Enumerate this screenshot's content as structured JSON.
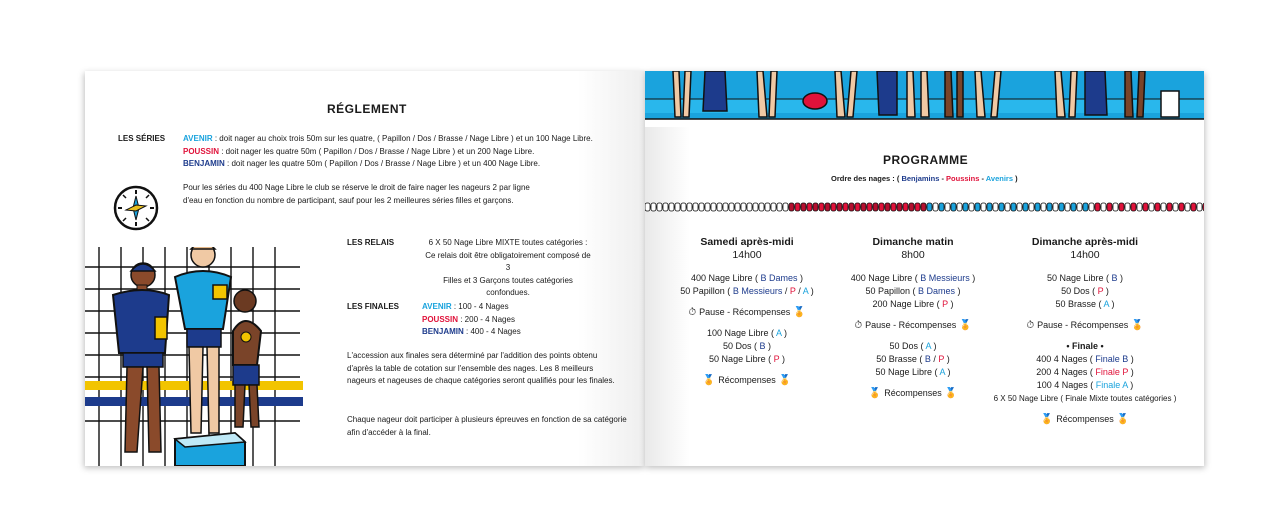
{
  "left": {
    "title": "RÉGLEMENT",
    "series_label": "LES SÉRIES",
    "series": [
      {
        "name": "AVENIR",
        "text": " : doit nager au choix trois 50m sur les quatre, ( Papillon / Dos / Brasse / Nage Libre ) et un 100 Nage Libre."
      },
      {
        "name": "POUSSIN",
        "text": " : doit nager les quatre 50m ( Papillon / Dos / Brasse / Nage Libre ) et un 200 Nage Libre."
      },
      {
        "name": "BENJAMIN",
        "text": " : doit nager les quatre 50m ( Papillon / Dos / Brasse / Nage Libre ) et un 400 Nage Libre."
      }
    ],
    "series_note_1": "Pour les séries du 400 Nage Libre le club se réserve le droit de faire nager les nageurs 2 par ligne",
    "series_note_2": "d'eau en fonction du nombre de participant, sauf pour les 2 meilleures séries filles et garçons.",
    "relais_label": "LES RELAIS",
    "relais_lines": [
      "6 X 50 Nage Libre MIXTE toutes catégories :",
      "Ce relais doit être obligatoirement composé de 3",
      "Filles et 3 Garçons toutes catégories confondues."
    ],
    "finales_label": "LES FINALES",
    "finales": [
      {
        "name": "AVENIR",
        "text": " : 100 - 4 Nages"
      },
      {
        "name": "POUSSIN",
        "text": " : 200 - 4 Nages"
      },
      {
        "name": "BENJAMIN",
        "text": " : 400 - 4 Nages"
      }
    ],
    "access_lines": [
      "L'accession aux finales sera déterminé par l'addition des points obtenu",
      "d'après la table de cotation sur l'ensemble des nages. Les 8 meilleurs",
      "nageurs et nageuses de chaque catégories seront qualifiés pour les finales."
    ],
    "chaque_lines": [
      "Chaque nageur doit participer à plusieurs épreuves en fonction de sa catégorie",
      "afin d'accéder à la final."
    ]
  },
  "right": {
    "title": "PROGRAMME",
    "order_prefix": "Ordre des nages : ( ",
    "order_benjamins": "Benjamins",
    "order_sep": " - ",
    "order_poussins": "Poussins",
    "order_avenirs": "Avenirs",
    "order_suffix": " )",
    "pause_label": "Pause - Récompenses",
    "recomp_label": "Récompenses",
    "finale_label": "• Finale •",
    "samedi": {
      "title": "Samedi après-midi",
      "time": "14h00",
      "b1l1_pre": "400 Nage Libre ( ",
      "b1l1_a": "B Dames",
      "b1l1_post": " )",
      "b1l2_pre": "50 Papillon ( ",
      "b1l2_a": "B Messieurs",
      "b1l2_s1": " / ",
      "b1l2_b": "P",
      "b1l2_s2": " / ",
      "b1l2_c": "A",
      "b1l2_post": " )",
      "b2l1_pre": "100 Nage Libre ( ",
      "b2l1_a": "A",
      "b2l1_post": " )",
      "b2l2_pre": "50 Dos ( ",
      "b2l2_a": "B",
      "b2l2_post": " )",
      "b2l3_pre": "50 Nage Libre ( ",
      "b2l3_a": "P",
      "b2l3_post": " )"
    },
    "dimanche_matin": {
      "title": "Dimanche matin",
      "time": "8h00",
      "b1l1_pre": "400 Nage Libre ( ",
      "b1l1_a": "B Messieurs",
      "b1l1_post": " )",
      "b1l2_pre": "50 Papillon ( ",
      "b1l2_a": "B Dames",
      "b1l2_post": " )",
      "b1l3_pre": "200 Nage Libre ( ",
      "b1l3_a": "P",
      "b1l3_post": " )",
      "b2l1_pre": "50 Dos ( ",
      "b2l1_a": "A",
      "b2l1_post": " )",
      "b2l2_pre": "50 Brasse ( ",
      "b2l2_a": "B",
      "b2l2_s1": " / ",
      "b2l2_b": "P",
      "b2l2_post": " )",
      "b2l3_pre": "50 Nage Libre ( ",
      "b2l3_a": "A",
      "b2l3_post": " )"
    },
    "dimanche_am": {
      "title": "Dimanche après-midi",
      "time": "14h00",
      "b1l1_pre": "50 Nage Libre ( ",
      "b1l1_a": "B",
      "b1l1_post": " )",
      "b1l2_pre": "50 Dos ( ",
      "b1l2_a": "P",
      "b1l2_post": " )",
      "b1l3_pre": "50 Brasse ( ",
      "b1l3_a": "A",
      "b1l3_post": " )",
      "f1_pre": "400 4 Nages ( ",
      "f1_a": "Finale B",
      "f1_post": " )",
      "f2_pre": "200 4 Nages ( ",
      "f2_a": "Finale P",
      "f2_post": " )",
      "f3_pre": "100 4 Nages ( ",
      "f3_a": "Finale A",
      "f3_post": " )",
      "relay": "6 X 50 Nage Libre ( Finale Mixte toutes catégories )"
    }
  },
  "colors": {
    "avenir": "#1aa3dd",
    "poussin": "#e0123a",
    "benjamin": "#1d3b8c",
    "pool": "#1aa3dd"
  },
  "icons": [
    "clock-icon",
    "stopwatch-icon",
    "medal-icon"
  ]
}
